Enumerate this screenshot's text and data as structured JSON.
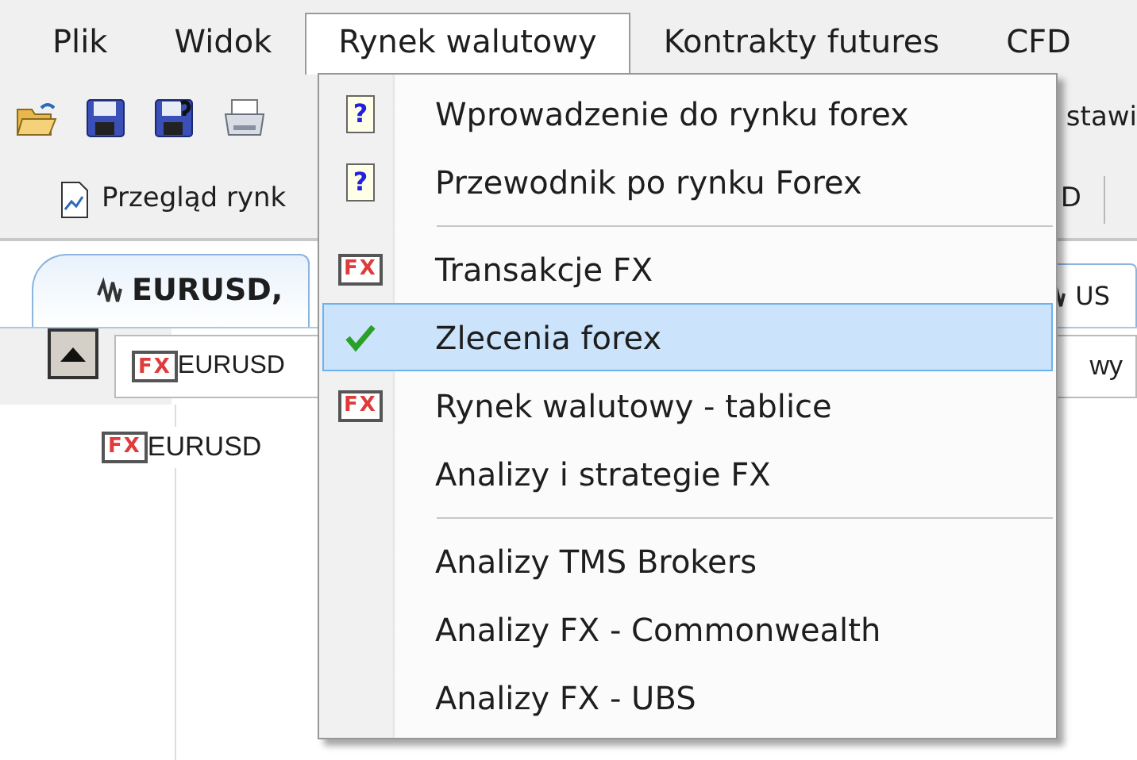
{
  "menubar": [
    {
      "label": "Plik",
      "selected": false
    },
    {
      "label": "Widok",
      "selected": false
    },
    {
      "label": "Rynek walutowy",
      "selected": true
    },
    {
      "label": "Kontrakty futures",
      "selected": false
    },
    {
      "label": "CFD",
      "selected": false
    }
  ],
  "toolbar": {
    "right_text": "stawi"
  },
  "toolbar2": {
    "button": "Przegląd rynk",
    "right_text": "D"
  },
  "tabs": [
    {
      "label": "EURUSD,",
      "selected": true
    },
    {
      "label": "US",
      "selected": false
    }
  ],
  "selector": {
    "badge": "FX",
    "value": "EURUSD",
    "right_text": "wy"
  },
  "tree": [
    {
      "badge": "FX",
      "label": "EURUSD"
    }
  ],
  "menu": [
    {
      "kind": "help",
      "badge": "?",
      "label": "Wprowadzenie do rynku forex",
      "checked": false,
      "selected": false
    },
    {
      "kind": "help",
      "badge": "?",
      "label": "Przewodnik po rynku Forex",
      "checked": false,
      "selected": false
    },
    {
      "kind": "separator"
    },
    {
      "kind": "fx",
      "badge": "FX",
      "label": "Transakcje FX",
      "checked": false,
      "selected": false
    },
    {
      "kind": "item",
      "label": "Zlecenia forex",
      "checked": true,
      "selected": true
    },
    {
      "kind": "fx",
      "badge": "FX",
      "label": "Rynek walutowy - tablice",
      "checked": false,
      "selected": false
    },
    {
      "kind": "item",
      "label": "Analizy i strategie FX",
      "checked": false,
      "selected": false
    },
    {
      "kind": "separator"
    },
    {
      "kind": "item",
      "label": "Analizy TMS Brokers",
      "checked": false,
      "selected": false
    },
    {
      "kind": "item",
      "label": "Analizy FX - Commonwealth",
      "checked": false,
      "selected": false
    },
    {
      "kind": "item",
      "label": "Analizy FX - UBS",
      "checked": false,
      "selected": false
    }
  ]
}
